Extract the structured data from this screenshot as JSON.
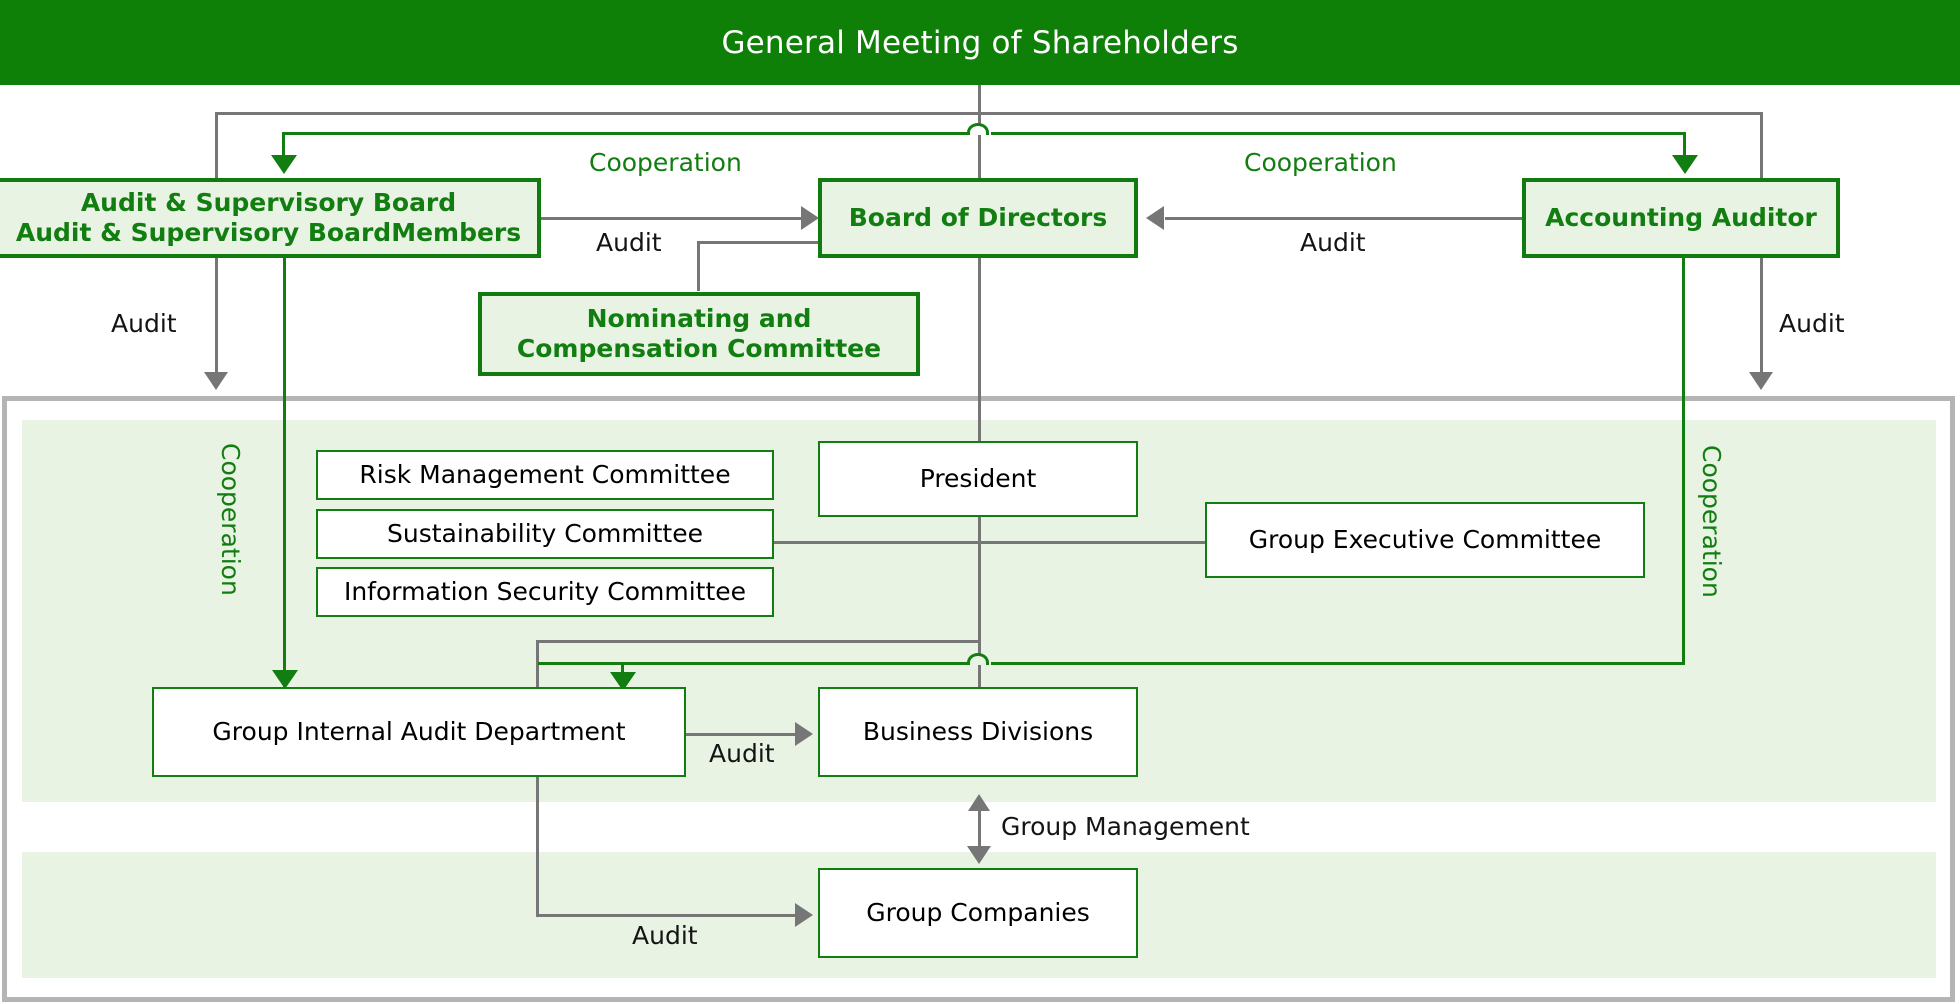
{
  "header": {
    "title": "General Meeting of Shareholders",
    "background": "#0e8008",
    "text_color": "#ffffff"
  },
  "colors": {
    "brand_green": "#127d10",
    "header_green": "#0e8008",
    "pale_green_fill": "#e8f3e4",
    "band_green": "#e8f3e4",
    "grey_line": "#767676",
    "grey_frame": "#b4b4b4",
    "white": "#ffffff",
    "black_text": "#141414"
  },
  "boxes": {
    "audit_supervisory_board": {
      "line1": "Audit & Supervisory Board",
      "line2": "Audit & Supervisory BoardMembers"
    },
    "board_of_directors": {
      "label": "Board of Directors"
    },
    "accounting_auditor": {
      "label": "Accounting Auditor"
    },
    "nominating_committee": {
      "line1": "Nominating and",
      "line2": "Compensation Committee"
    },
    "risk_management_committee": {
      "label": "Risk Management Committee"
    },
    "sustainability_committee": {
      "label": "Sustainability Committee"
    },
    "information_security_committee": {
      "label": "Information Security Committee"
    },
    "president": {
      "label": "President"
    },
    "group_executive_committee": {
      "label": "Group Executive Committee"
    },
    "group_internal_audit_department": {
      "label": "Group Internal Audit Department"
    },
    "business_divisions": {
      "label": "Business Divisions"
    },
    "group_companies": {
      "label": "Group Companies"
    }
  },
  "edge_labels": {
    "cooperation_left_top": "Cooperation",
    "cooperation_right_top": "Cooperation",
    "cooperation_left_vertical": "Cooperation",
    "cooperation_right_vertical": "Cooperation",
    "audit_asb_to_bod": "Audit",
    "audit_aa_to_bod": "Audit",
    "audit_left_down": "Audit",
    "audit_right_down": "Audit",
    "audit_giad_to_divisions": "Audit",
    "audit_giad_to_companies": "Audit",
    "group_management": "Group Management"
  }
}
